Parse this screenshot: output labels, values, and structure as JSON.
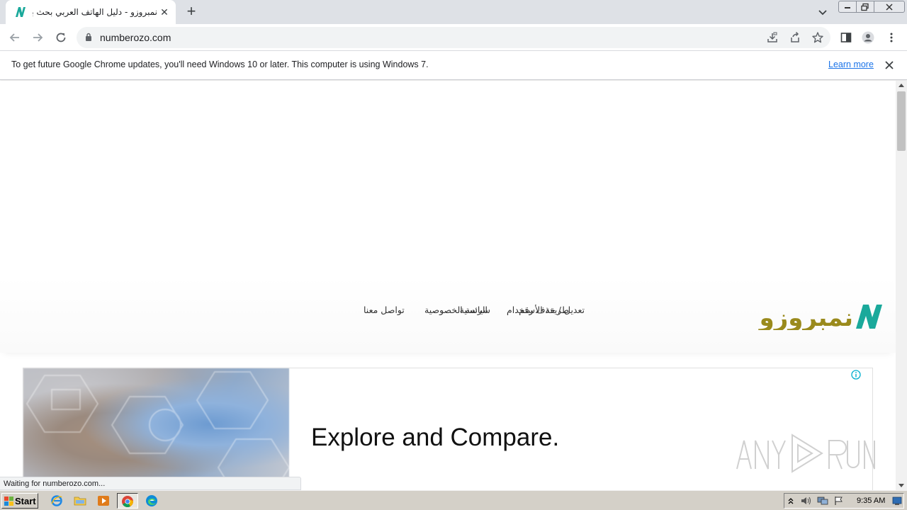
{
  "browser": {
    "tab_title": "نمبروزو - دليل الهاتف العربي بحث بالاسم",
    "url": "numberozo.com"
  },
  "infobar": {
    "message": "To get future Google Chrome updates, you'll need Windows 10 or later. This computer is using Windows 7.",
    "learn_more": "Learn more"
  },
  "site": {
    "logo_text": "نمبروزو",
    "nav": [
      {
        "label": "الرئسية"
      },
      {
        "label": "تعديل / حذف رقم"
      },
      {
        "label": "طريقة الأستخدام"
      },
      {
        "label": "سياسة الخصوصية"
      },
      {
        "label": "تواصل معنا"
      }
    ],
    "colors": {
      "logo_teal": "#1aa99b",
      "logo_olive": "#9a8a1c"
    }
  },
  "ad": {
    "headline": "Explore and Compare."
  },
  "watermark": {
    "text": "ANY RUN"
  },
  "status": {
    "text": "Waiting for numberozo.com..."
  },
  "taskbar": {
    "start_label": "Start",
    "time": "9:35 AM"
  }
}
